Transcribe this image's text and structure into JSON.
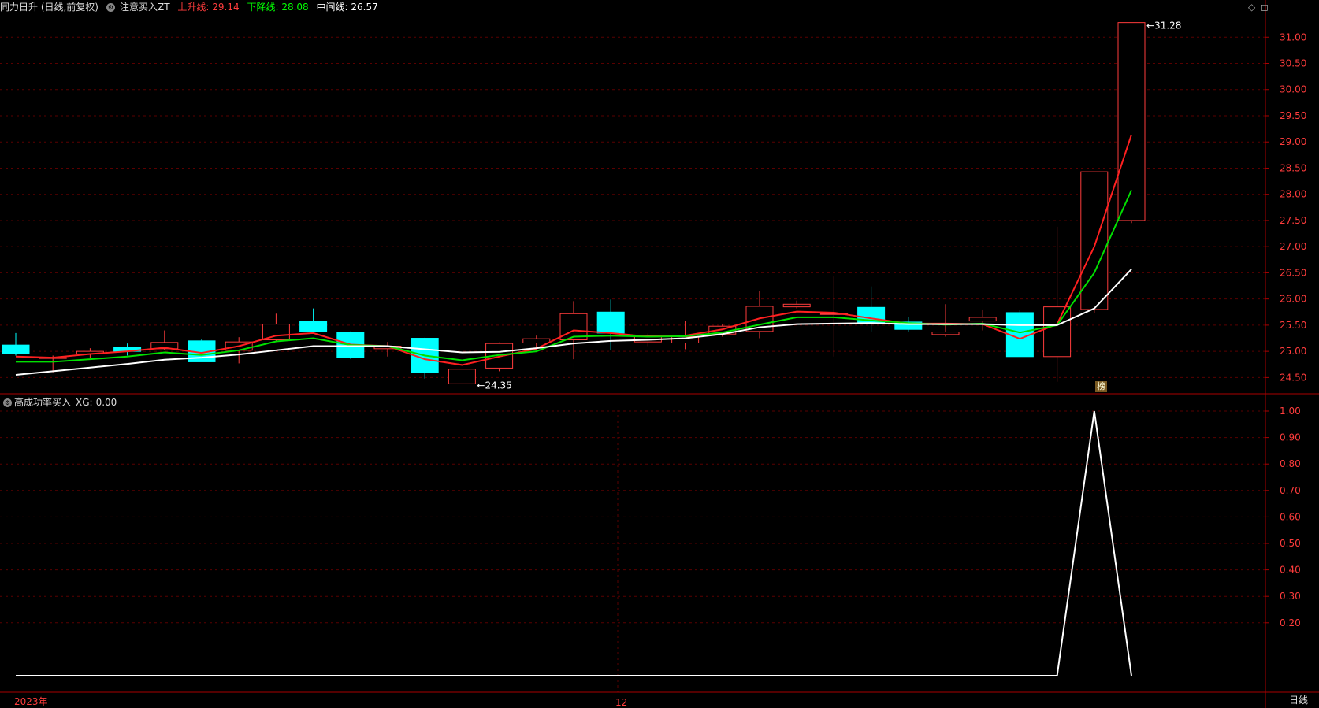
{
  "header": {
    "stock": "同力日升 (日线,前复权)",
    "indicator_name": "注意买入ZT",
    "upper_label": "上升线:",
    "upper_value": "29.14",
    "lower_label": "下降线:",
    "lower_value": "28.08",
    "mid_label": "中间线:",
    "mid_value": "26.57"
  },
  "sub_header": {
    "indicator_name": "高成功率买入",
    "xg_label": "XG:",
    "xg_value": "0.00"
  },
  "corner_icons": [
    "diamond-icon",
    "frame-icon"
  ],
  "x_labels": {
    "year": "2023年",
    "month": "12"
  },
  "timeframe": "日线",
  "badge": "榜",
  "colors": {
    "up": "#ff3c3c",
    "down": "#00ffff",
    "green_line": "#00ff00",
    "white_line": "#ffffff",
    "grid": "#5a0000",
    "axis": "#aa0000"
  },
  "chart_data": [
    {
      "type": "candlestick",
      "y_ticks": [
        "31.00",
        "30.50",
        "30.00",
        "29.50",
        "29.00",
        "28.50",
        "28.00",
        "27.50",
        "27.00",
        "26.50",
        "26.00",
        "25.50",
        "25.00",
        "24.50"
      ],
      "ylim": [
        24.25,
        31.38
      ],
      "annotations": [
        {
          "label": "31.28",
          "index": 30
        },
        {
          "label": "24.35",
          "index": 12
        }
      ],
      "candles": [
        {
          "o": 25.12,
          "c": 24.95,
          "h": 25.35,
          "l": 24.92
        },
        {
          "o": 24.88,
          "c": 24.88,
          "h": 24.92,
          "l": 24.6
        },
        {
          "o": 24.95,
          "c": 25.0,
          "h": 25.06,
          "l": 24.88
        },
        {
          "o": 25.08,
          "c": 25.0,
          "h": 25.15,
          "l": 24.92
        },
        {
          "o": 25.05,
          "c": 25.17,
          "h": 25.4,
          "l": 25.03
        },
        {
          "o": 25.2,
          "c": 24.8,
          "h": 25.24,
          "l": 24.8
        },
        {
          "o": 25.02,
          "c": 25.18,
          "h": 25.27,
          "l": 24.77
        },
        {
          "o": 25.22,
          "c": 25.52,
          "h": 25.72,
          "l": 25.2
        },
        {
          "o": 25.58,
          "c": 25.38,
          "h": 25.82,
          "l": 25.36
        },
        {
          "o": 25.36,
          "c": 24.88,
          "h": 25.38,
          "l": 24.86
        },
        {
          "o": 25.05,
          "c": 25.1,
          "h": 25.18,
          "l": 24.9
        },
        {
          "o": 25.25,
          "c": 24.6,
          "h": 25.26,
          "l": 24.48
        },
        {
          "o": 24.38,
          "c": 24.66,
          "h": 24.66,
          "l": 24.38
        },
        {
          "o": 24.68,
          "c": 25.15,
          "h": 25.17,
          "l": 24.62
        },
        {
          "o": 25.16,
          "c": 25.24,
          "h": 25.3,
          "l": 25.05
        },
        {
          "o": 25.22,
          "c": 25.72,
          "h": 25.96,
          "l": 24.85
        },
        {
          "o": 25.75,
          "c": 25.35,
          "h": 25.99,
          "l": 25.03
        },
        {
          "o": 25.18,
          "c": 25.3,
          "h": 25.34,
          "l": 25.1
        },
        {
          "o": 25.16,
          "c": 25.28,
          "h": 25.58,
          "l": 25.04
        },
        {
          "o": 25.33,
          "c": 25.48,
          "h": 25.52,
          "l": 25.28
        },
        {
          "o": 25.38,
          "c": 25.86,
          "h": 26.16,
          "l": 25.25
        },
        {
          "o": 25.85,
          "c": 25.9,
          "h": 25.97,
          "l": 25.82
        },
        {
          "o": 25.72,
          "c": 25.72,
          "h": 26.43,
          "l": 24.9
        },
        {
          "o": 25.84,
          "c": 25.55,
          "h": 26.24,
          "l": 25.38
        },
        {
          "o": 25.56,
          "c": 25.42,
          "h": 25.66,
          "l": 25.38
        },
        {
          "o": 25.32,
          "c": 25.37,
          "h": 25.9,
          "l": 25.28
        },
        {
          "o": 25.58,
          "c": 25.65,
          "h": 25.8,
          "l": 25.4
        },
        {
          "o": 25.74,
          "c": 24.9,
          "h": 25.79,
          "l": 24.9
        },
        {
          "o": 24.9,
          "c": 25.85,
          "h": 27.38,
          "l": 24.42
        },
        {
          "o": 25.8,
          "c": 28.43,
          "h": 28.43,
          "l": 25.74
        },
        {
          "o": 27.5,
          "c": 31.28,
          "h": 31.28,
          "l": 27.45
        }
      ],
      "series": [
        {
          "name": "上升线",
          "color": "#ff2020",
          "values": [
            24.9,
            24.88,
            24.95,
            25.0,
            25.07,
            24.97,
            25.1,
            25.3,
            25.35,
            25.13,
            25.1,
            24.85,
            24.74,
            24.9,
            25.05,
            25.4,
            25.35,
            25.28,
            25.3,
            25.42,
            25.63,
            25.76,
            25.74,
            25.63,
            25.53,
            25.53,
            25.52,
            25.24,
            25.52,
            27.0,
            29.14
          ]
        },
        {
          "name": "下降线",
          "color": "#00e000",
          "values": [
            24.8,
            24.8,
            24.85,
            24.9,
            24.98,
            24.93,
            25.02,
            25.19,
            25.25,
            25.12,
            25.1,
            24.92,
            24.83,
            24.93,
            25.0,
            25.28,
            25.3,
            25.28,
            25.29,
            25.36,
            25.51,
            25.65,
            25.65,
            25.59,
            25.54,
            25.51,
            25.53,
            25.36,
            25.5,
            26.5,
            28.08
          ]
        },
        {
          "name": "中间线",
          "color": "#ffffff",
          "values": [
            24.55,
            24.62,
            24.69,
            24.76,
            24.84,
            24.88,
            24.94,
            25.02,
            25.1,
            25.1,
            25.1,
            25.04,
            24.98,
            24.99,
            25.06,
            25.15,
            25.2,
            25.22,
            25.25,
            25.33,
            25.46,
            25.52,
            25.53,
            25.54,
            25.52,
            25.52,
            25.52,
            25.5,
            25.5,
            25.82,
            26.57
          ]
        }
      ]
    },
    {
      "type": "line",
      "y_ticks": [
        "1.00",
        "0.90",
        "0.80",
        "0.70",
        "0.60",
        "0.50",
        "0.40",
        "0.30",
        "0.20"
      ],
      "ylim": [
        0,
        1
      ],
      "series": [
        {
          "name": "XG",
          "color": "#ffffff",
          "values": [
            0,
            0,
            0,
            0,
            0,
            0,
            0,
            0,
            0,
            0,
            0,
            0,
            0,
            0,
            0,
            0,
            0,
            0,
            0,
            0,
            0,
            0,
            0,
            0,
            0,
            0,
            0,
            0,
            0,
            1,
            0
          ]
        }
      ]
    }
  ]
}
